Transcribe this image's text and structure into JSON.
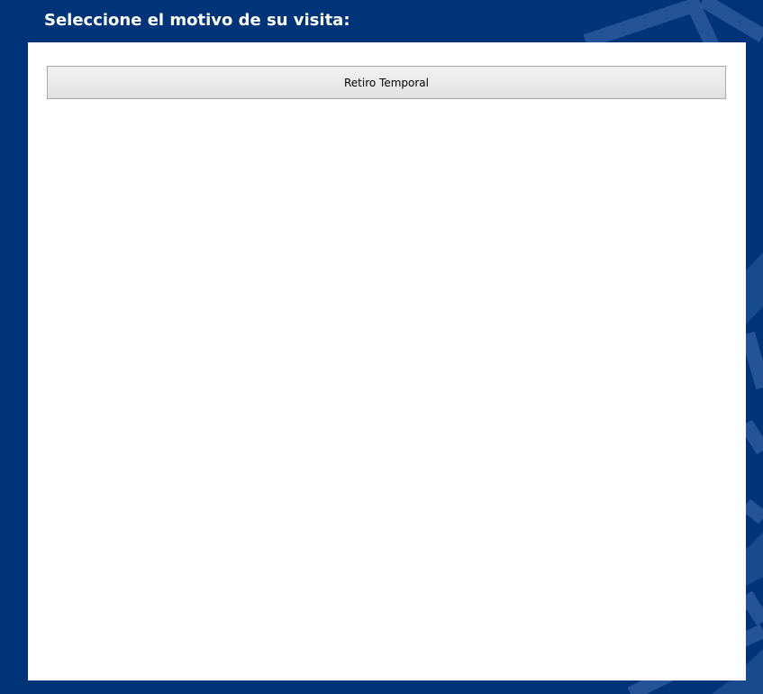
{
  "header": {
    "title": "Seleccione el motivo de su visita:"
  },
  "options": [
    {
      "label": "Retiro Temporal"
    }
  ],
  "colors": {
    "background": "#003478",
    "decor": "#2a5a9c",
    "panel": "#ffffff",
    "button_border": "#a9a9a9",
    "title_text": "#ffffff"
  }
}
